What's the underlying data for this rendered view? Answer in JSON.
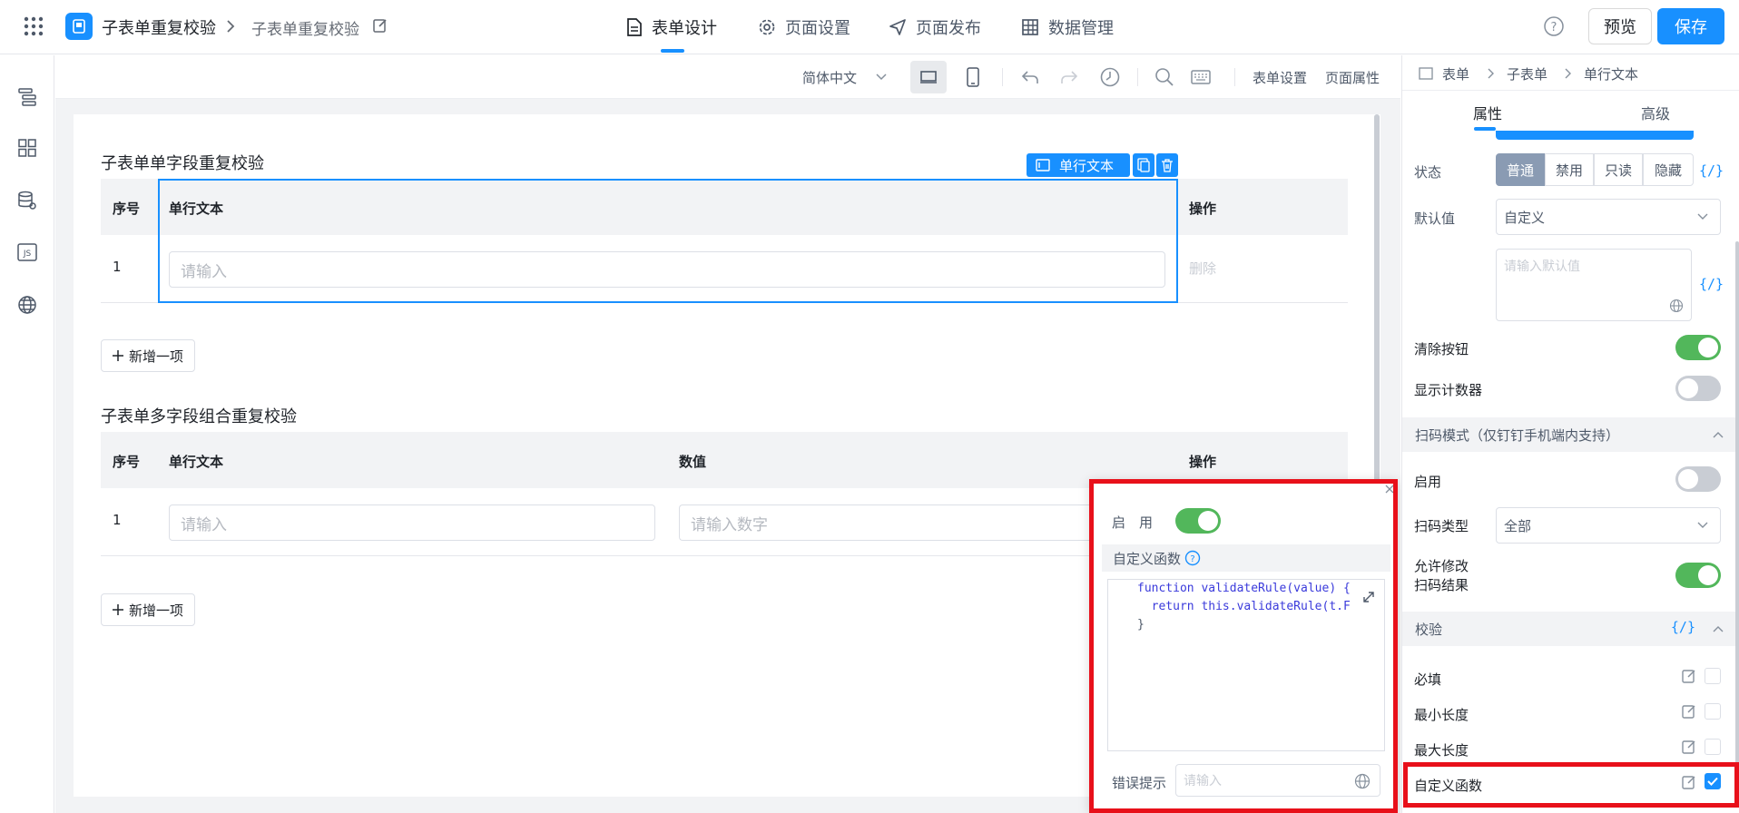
{
  "header": {
    "app_title": "子表单重复校验",
    "form_title": "子表单重复校验",
    "tabs": [
      {
        "label": "表单设计",
        "icon": "document-icon",
        "active": true
      },
      {
        "label": "页面设置",
        "icon": "gear-icon",
        "active": false
      },
      {
        "label": "页面发布",
        "icon": "send-icon",
        "active": false
      },
      {
        "label": "数据管理",
        "icon": "table-icon",
        "active": false
      }
    ],
    "preview_label": "预览",
    "save_label": "保存",
    "accent_color": "#1890ff"
  },
  "left_rail": {
    "icons": [
      "outline-icon",
      "components-icon",
      "data-source-icon",
      "js-icon",
      "globe-icon"
    ],
    "js_text": "JS"
  },
  "toolbar": {
    "language": "简体中文",
    "form_settings": "表单设置",
    "page_props": "页面属性"
  },
  "canvas": {
    "table1": {
      "title": "子表单单字段重复校验",
      "headers": [
        "序号",
        "单行文本",
        "操作"
      ],
      "rows": [
        {
          "index": "1",
          "placeholder": "请输入",
          "action": "删除"
        }
      ],
      "add_label": "新增一项"
    },
    "table2": {
      "title": "子表单多字段组合重复校验",
      "headers": [
        "序号",
        "单行文本",
        "数值",
        "操作"
      ],
      "rows": [
        {
          "index": "1",
          "text_placeholder": "请输入",
          "number_placeholder": "请输入数字"
        }
      ],
      "add_label": "新增一项"
    },
    "selected_field_tag": "单行文本"
  },
  "popover": {
    "enable_label": "启　用",
    "enabled": true,
    "custom_fn_label": "自定义函数",
    "code": [
      "function validateRule(value) {",
      "  return this.validateRule(t.F",
      "}"
    ],
    "error_tip_label": "错误提示",
    "error_tip_placeholder": "请输入",
    "highlight_color": "#e8101a"
  },
  "right_panel": {
    "breadcrumb": [
      "表单",
      "子表单",
      "单行文本"
    ],
    "tabs": [
      "属性",
      "高级"
    ],
    "status_label": "状态",
    "status_options": [
      "普通",
      "禁用",
      "只读",
      "隐藏"
    ],
    "status_selected": "普通",
    "fx_label": "{/}",
    "default_label": "默认值",
    "default_mode": "自定义",
    "default_placeholder": "请输入默认值",
    "clear_button_label": "清除按钮",
    "clear_button_on": true,
    "show_counter_label": "显示计数器",
    "show_counter_on": false,
    "scan_section_title": "扫码模式（仅钉钉手机端内支持）",
    "scan_enable_label": "启用",
    "scan_enable_on": false,
    "scan_type_label": "扫码类型",
    "scan_type_value": "全部",
    "allow_edit_label": "允许修改扫码结果",
    "allow_edit_on": true,
    "validation_title": "校验",
    "rules": [
      {
        "label": "必填",
        "checked": false
      },
      {
        "label": "最小长度",
        "checked": false
      },
      {
        "label": "最大长度",
        "checked": false
      },
      {
        "label": "自定义函数",
        "checked": true
      }
    ]
  }
}
